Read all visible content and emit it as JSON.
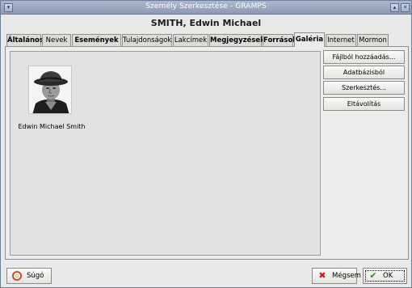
{
  "window": {
    "title": "Személy Szerkesztése - GRAMPS"
  },
  "person": {
    "name": "SMITH, Edwin Michael"
  },
  "tabs": [
    {
      "label": "Általános",
      "bold": true
    },
    {
      "label": "Nevek",
      "bold": false
    },
    {
      "label": "Események",
      "bold": true
    },
    {
      "label": "Tulajdonságok",
      "bold": false
    },
    {
      "label": "Lakcímek",
      "bold": false
    },
    {
      "label": "Megjegyzések",
      "bold": true
    },
    {
      "label": "Források",
      "bold": true
    },
    {
      "label": "Galéria",
      "bold": true,
      "active": true
    },
    {
      "label": "Internet",
      "bold": false
    },
    {
      "label": "Mormon",
      "bold": false
    }
  ],
  "gallery": {
    "items": [
      {
        "caption": "Edwin Michael Smith",
        "icon": "person-photo"
      }
    ]
  },
  "actions": {
    "add_from_file": "Fájlból hozzáadás...",
    "add_from_db": "Adatbázisból hozzáadás...",
    "edit": "Szerkesztés...",
    "remove": "Eltávolítás"
  },
  "footer": {
    "help": "Súgó",
    "cancel": "Mégsem",
    "ok": "OK",
    "help_icon": "lifebuoy-icon",
    "cancel_icon": "x-icon",
    "ok_icon": "check-icon"
  },
  "colors": {
    "titlebar": "#8d9ab5",
    "cancel_icon": "#d11a1a",
    "ok_icon": "#2d8a23",
    "help_icon": "#d24b1a"
  }
}
